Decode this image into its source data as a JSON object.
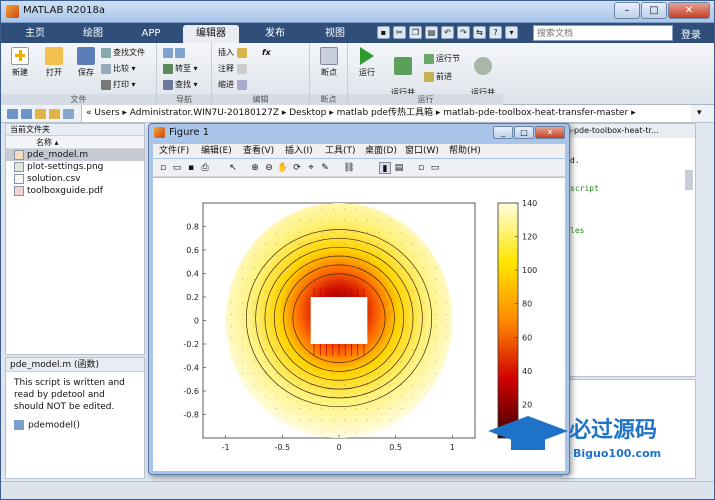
{
  "window": {
    "title": "MATLAB R2018a",
    "min": "–",
    "max": "□",
    "close": "✕"
  },
  "tabs": [
    "主页",
    "绘图",
    "APP",
    "编辑器",
    "发布",
    "视图"
  ],
  "active_tab": "编辑器",
  "search": {
    "placeholder": "搜索文档"
  },
  "login": "登录",
  "ribbon": {
    "file": {
      "label": "文件",
      "new": "新建",
      "open": "打开",
      "save": "保存",
      "find_files": "查找文件",
      "compare": "比较",
      "print": "打印"
    },
    "navigate": {
      "label": "导航",
      "goto": "转至",
      "find": "查找"
    },
    "edit": {
      "label": "编辑",
      "insert": "插入",
      "comment": "注释",
      "indent": "缩进",
      "fx": "fx"
    },
    "breakpoints": {
      "label": "断点",
      "breakpoints": "断点"
    },
    "run": {
      "label": "运行",
      "run": "运行",
      "run_advance": "运行并\n前进",
      "run_section": "运行节",
      "advance": "前进",
      "run_time": "运行并\n计时"
    }
  },
  "address": {
    "path": "« Users ▸ Administrator.WIN7U-20180127Z ▸ Desktop ▸ matlab pde传热工具箱 ▸ matlab-pde-toolbox-heat-transfer-master ▸"
  },
  "current_folder": {
    "title": "当前文件夹",
    "column": "名称 ▴",
    "files": [
      "pde_model.m",
      "plot-settings.png",
      "solution.csv",
      "toolboxguide.pdf"
    ],
    "selected": 0
  },
  "details": {
    "title": "pde_model.m  (函数)",
    "text": "This script is written and read by pdetool and should NOT be edited.",
    "function": "pdemodel()"
  },
  "editor_right": {
    "header": "n-pde-toolbox-heat-tr...",
    "lines": [
      "d.",
      "script",
      "les"
    ]
  },
  "figure": {
    "title": "Figure 1",
    "min": "_",
    "max": "□",
    "close": "✕",
    "menu": [
      "文件(F)",
      "编辑(E)",
      "查看(V)",
      "插入(I)",
      "工具(T)",
      "桌面(D)",
      "窗口(W)",
      "帮助(H)"
    ]
  },
  "chart_data": {
    "type": "heatmap",
    "title": "",
    "xlabel": "",
    "ylabel": "",
    "xlim": [
      -1.2,
      1.2
    ],
    "ylim": [
      -1,
      1
    ],
    "xticks": [
      -1,
      -0.5,
      0,
      0.5,
      1
    ],
    "yticks": [
      0.8,
      0.6,
      0.4,
      0.2,
      0,
      -0.2,
      -0.4,
      -0.6,
      -0.8
    ],
    "colorbar": {
      "min": 0,
      "max": 140,
      "ticks": [
        140,
        120,
        100,
        80,
        60,
        40,
        20
      ]
    },
    "contour_levels": [
      20,
      40,
      60,
      80,
      100,
      120
    ],
    "domain": "disk radius 1 with square hole (-0.25..0.25, -0.2..0.2) at 0,0",
    "colormap": "hot",
    "colors": {
      "low": "#fffde8",
      "mid": "#ffd700",
      "high": "#e02000",
      "peak": "#600000"
    }
  },
  "watermark": {
    "text": "必过源码",
    "url": "Biguo100.com"
  }
}
